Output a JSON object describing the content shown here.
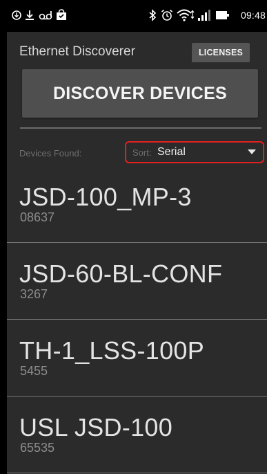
{
  "status_bar": {
    "time": "09:48",
    "icons": [
      "usb-debug-icon",
      "download-icon",
      "voicemail-icon",
      "bag-icon",
      "bluetooth-icon",
      "alarm-icon",
      "wifi-icon",
      "signal-icon",
      "battery-icon"
    ]
  },
  "header": {
    "title": "Ethernet Discoverer",
    "licenses_label": "LICENSES"
  },
  "discover_label": "DISCOVER DEVICES",
  "filter": {
    "devices_found_label": "Devices Found:",
    "sort_label": "Sort:",
    "sort_value": "Serial"
  },
  "devices": [
    {
      "name": "JSD-100_MP-3",
      "serial": "08637"
    },
    {
      "name": "JSD-60-BL-CONF",
      "serial": "3267"
    },
    {
      "name": "TH-1_LSS-100P",
      "serial": "5455"
    },
    {
      "name": "USL JSD-100",
      "serial": "65535"
    }
  ],
  "colors": {
    "background": "#2b2b2b",
    "status_bar": "#000000",
    "button": "#4f4f4f",
    "highlight_border": "#e02020"
  }
}
